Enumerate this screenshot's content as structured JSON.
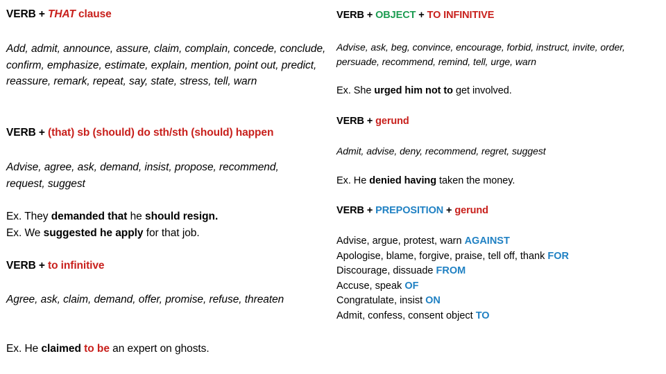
{
  "left": {
    "heading_that_clause": {
      "verb": "VERB",
      "plus": " + ",
      "that": "THAT",
      "clause": " clause"
    },
    "that_clause_verbs": "Add, admit, announce, assure, claim, complain, concede, conclude, confirm, emphasize, estimate, explain, mention, point out, predict, reassure, remark, repeat, say, state, stress, tell, warn",
    "heading_subjunctive": {
      "verb": "VERB",
      "plus": " + ",
      "pattern": "(that) sb (should) do sth/sth (should) happen"
    },
    "subjunctive_verbs": "Advise, agree, ask, demand, insist, propose, recommend, request, suggest",
    "examples_subjunctive": [
      {
        "prefix": "Ex. They ",
        "bold1": "demanded that",
        "middle": " he ",
        "bold2": "should resign.",
        "suffix": ""
      },
      {
        "prefix": "Ex. We ",
        "bold1": "suggested he apply",
        "middle": " for that job.",
        "bold2": "",
        "suffix": ""
      }
    ],
    "heading_to_infinitive": {
      "verb": "VERB",
      "plus": " + ",
      "pattern": "to infinitive"
    },
    "to_infinitive_verbs": "Agree, ask, claim, demand, offer, promise, refuse, threaten",
    "example_to_infinitive": {
      "prefix": "Ex. He ",
      "bold_black": "claimed",
      "space": " ",
      "bold_red": "to be",
      "suffix": " an expert on ghosts."
    }
  },
  "right": {
    "heading_object_to_infinitive": {
      "verb": "VERB",
      "plus1": " + ",
      "object": "OBJECT",
      "plus2": " + ",
      "to_infinitive": "TO INFINITIVE"
    },
    "object_to_infinitive_verbs": "Advise, ask, beg, convince, encourage, forbid, instruct, invite, order, persuade, recommend, remind, tell, urge, warn",
    "example_object_to_infinitive": {
      "prefix": "Ex. She ",
      "bold": "urged him not to",
      "suffix": " get involved."
    },
    "heading_gerund": {
      "verb": "VERB",
      "plus": " + ",
      "pattern": "gerund"
    },
    "gerund_verbs": "Admit, advise, deny, recommend, regret, suggest",
    "example_gerund": {
      "prefix": "Ex. He ",
      "bold": "denied having",
      "suffix": " taken the money."
    },
    "heading_preposition_gerund": {
      "verb": "VERB",
      "plus1": " + ",
      "preposition": "PREPOSITION",
      "plus2": " + ",
      "gerund": "gerund"
    },
    "preposition_rows": [
      {
        "verbs": "Advise, argue, protest, warn ",
        "preposition": "AGAINST"
      },
      {
        "verbs": "Apologise, blame, forgive, praise, tell off, thank ",
        "preposition": "FOR"
      },
      {
        "verbs": "Discourage, dissuade ",
        "preposition": "FROM"
      },
      {
        "verbs": "Accuse, speak ",
        "preposition": "OF"
      },
      {
        "verbs": "Congratulate, insist ",
        "preposition": "ON"
      },
      {
        "verbs": "Admit, confess, consent object ",
        "preposition": "TO"
      }
    ]
  },
  "colors": {
    "red": "#C8201C",
    "green": "#1D9C52",
    "blue": "#2081C3",
    "text": "#000000",
    "background": "#FFFFFF"
  }
}
